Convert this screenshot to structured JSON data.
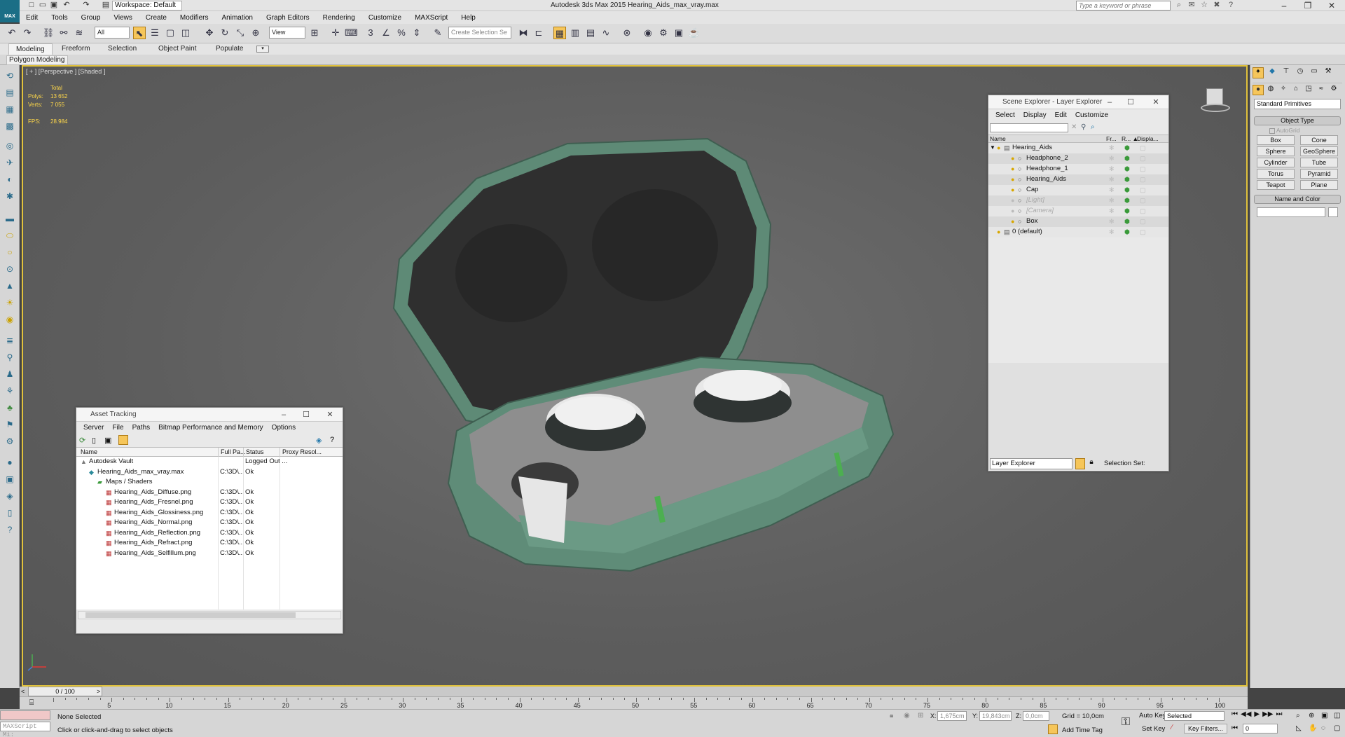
{
  "app": {
    "logo_label": "MAX",
    "workspace": "Workspace: Default",
    "title": "Autodesk 3ds Max  2015     Hearing_Aids_max_vray.max",
    "search_placeholder": "Type a keyword or phrase"
  },
  "menu": [
    "Edit",
    "Tools",
    "Group",
    "Views",
    "Create",
    "Modifiers",
    "Animation",
    "Graph Editors",
    "Rendering",
    "Customize",
    "MAXScript",
    "Help"
  ],
  "toolbar": {
    "filter": "All",
    "ref_coord": "View",
    "selection_set": "Create Selection Se"
  },
  "ribbon": {
    "tabs": [
      "Modeling",
      "Freeform",
      "Selection",
      "Object Paint",
      "Populate"
    ],
    "active_panel": "Polygon Modeling"
  },
  "viewport": {
    "label": "[ + ] [Perspective ] [Shaded ]",
    "stats_header": "Total",
    "polys_label": "Polys:",
    "polys_value": "13 652",
    "verts_label": "Verts:",
    "verts_value": "7 055",
    "fps_label": "FPS:",
    "fps_value": "28.984"
  },
  "scene_explorer": {
    "title": "Scene Explorer - Layer Explorer",
    "menu": [
      "Select",
      "Display",
      "Edit",
      "Customize"
    ],
    "columns": [
      "Name",
      "Fr...",
      "R... ▲",
      "Displa..."
    ],
    "rows": [
      {
        "name": "Hearing_Aids",
        "indent": 0,
        "type": "layer"
      },
      {
        "name": "Headphone_2",
        "indent": 1,
        "type": "object"
      },
      {
        "name": "Headphone_1",
        "indent": 1,
        "type": "object"
      },
      {
        "name": "Hearing_Aids",
        "indent": 1,
        "type": "object"
      },
      {
        "name": "Cap",
        "indent": 1,
        "type": "object"
      },
      {
        "name": "[Light]",
        "indent": 1,
        "type": "hidden"
      },
      {
        "name": "[Camera]",
        "indent": 1,
        "type": "hidden"
      },
      {
        "name": "Box",
        "indent": 1,
        "type": "object"
      },
      {
        "name": "0 (default)",
        "indent": 0,
        "type": "layer"
      }
    ],
    "footer_dropdown": "Layer Explorer",
    "selection_set_label": "Selection Set:"
  },
  "asset_tracking": {
    "title": "Asset Tracking",
    "menu": [
      "Server",
      "File",
      "Paths",
      "Bitmap Performance and Memory",
      "Options"
    ],
    "columns": [
      "Name",
      "Full Pa...",
      "Status",
      "Proxy Resol..."
    ],
    "rows": [
      {
        "name": "Autodesk Vault",
        "path": "",
        "status": "Logged Out ...",
        "indent": 1,
        "icon": "vault"
      },
      {
        "name": "Hearing_Aids_max_vray.max",
        "path": "C:\\3D\\...",
        "status": "Ok",
        "indent": 2,
        "icon": "max"
      },
      {
        "name": "Maps / Shaders",
        "path": "",
        "status": "",
        "indent": 3,
        "icon": "folder"
      },
      {
        "name": "Hearing_Aids_Diffuse.png",
        "path": "C:\\3D\\...",
        "status": "Ok",
        "indent": 4,
        "icon": "image"
      },
      {
        "name": "Hearing_Aids_Fresnel.png",
        "path": "C:\\3D\\...",
        "status": "Ok",
        "indent": 4,
        "icon": "image"
      },
      {
        "name": "Hearing_Aids_Glossiness.png",
        "path": "C:\\3D\\...",
        "status": "Ok",
        "indent": 4,
        "icon": "image"
      },
      {
        "name": "Hearing_Aids_Normal.png",
        "path": "C:\\3D\\...",
        "status": "Ok",
        "indent": 4,
        "icon": "image"
      },
      {
        "name": "Hearing_Aids_Reflection.png",
        "path": "C:\\3D\\...",
        "status": "Ok",
        "indent": 4,
        "icon": "image"
      },
      {
        "name": "Hearing_Aids_Refract.png",
        "path": "C:\\3D\\...",
        "status": "Ok",
        "indent": 4,
        "icon": "image"
      },
      {
        "name": "Hearing_Aids_Selfillum.png",
        "path": "C:\\3D\\...",
        "status": "Ok",
        "indent": 4,
        "icon": "image"
      }
    ]
  },
  "command_panel": {
    "category": "Standard Primitives",
    "object_type_title": "Object Type",
    "autogrid": "AutoGrid",
    "primitives": [
      "Box",
      "Cone",
      "Sphere",
      "GeoSphere",
      "Cylinder",
      "Tube",
      "Torus",
      "Pyramid",
      "Teapot",
      "Plane"
    ],
    "name_color_title": "Name and Color"
  },
  "timeline": {
    "frame_counter": "0 / 100",
    "ticks": [
      0,
      5,
      10,
      15,
      20,
      25,
      30,
      35,
      40,
      45,
      50,
      55,
      60,
      65,
      70,
      75,
      80,
      85,
      90,
      95,
      100
    ]
  },
  "status": {
    "maxscript": "MAXScript Mi:",
    "selection": "None Selected",
    "prompt": "Click or click-and-drag to select objects",
    "x_label": "X:",
    "x_value": "1,675cm",
    "y_label": "Y:",
    "y_value": "19,843cm",
    "z_label": "Z:",
    "z_value": "0,0cm",
    "grid": "Grid = 10,0cm",
    "add_time_tag": "Add Time Tag",
    "auto_key": "Auto Key",
    "set_key": "Set Key",
    "key_mode": "Selected",
    "key_filters": "Key Filters...",
    "current_frame": "0"
  },
  "colors": {
    "viewport_border": "#e1c23c",
    "case_green": "#5f8c78",
    "stats_yellow": "#ffd84a"
  }
}
